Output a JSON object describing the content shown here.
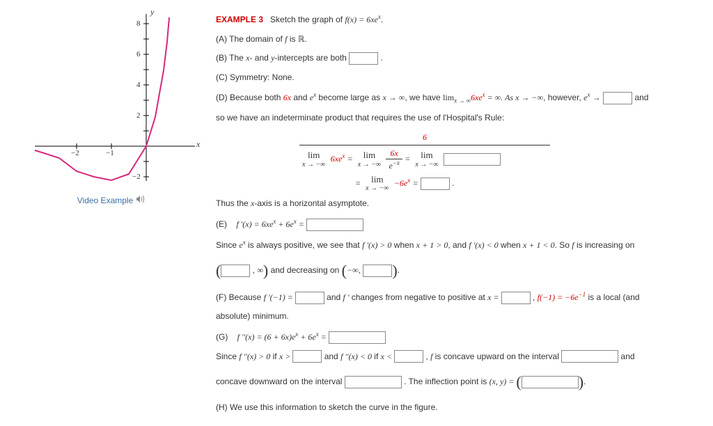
{
  "example_label": "EXAMPLE 3",
  "prompt_prefix": "Sketch the graph of ",
  "prompt_fn": "f(x) = 6xe",
  "prompt_exp": "x",
  "prompt_suffix": ".",
  "video_link": "Video Example",
  "A": {
    "prefix": "(A) The domain of ",
    "fvar": "f",
    "mid": " is ",
    "set": "ℝ",
    "suffix": "."
  },
  "B": {
    "prefix": "(B) The ",
    "x": "x",
    "mid1": "- and ",
    "y": "y",
    "mid2": "-intercepts are both ",
    "suffix": " ."
  },
  "C": "(C) Symmetry: None.",
  "D": {
    "line1a": "(D) Because both ",
    "sixx": "6x",
    "line1b": " and ",
    "ex": "e",
    "exexp": "x",
    "line1c": " become large as ",
    "xto": "x → ∞",
    "line1d": ", we have ",
    "limtxt": "lim",
    "limsub": "x → ∞",
    "limexpr": "6xe",
    "limexp": "x",
    "eqinf": " = ∞. As ",
    "xtoneg": "x → −∞",
    "line1e": ", however, ",
    "exto": "e",
    "line1f": " → ",
    "tail": " and",
    "line2": "so we have an indeterminate product that requires the use of l'Hospital's Rule:",
    "topred": "6",
    "eq": " = ",
    "six": "6",
    "neg6ex": "−6e",
    "closing": "Thus the ",
    "xaxis": "x",
    "closing2": "-axis is a horizontal asymptote."
  },
  "E": {
    "label": "(E)",
    "fprime": "f '(x) = 6xe",
    "exp": "x",
    "plus": " + 6e",
    "eq": " = ",
    "line2a": "Since ",
    "ex": "e",
    "line2b": " is always positive, we see that ",
    "fpx": "f '(x) > 0",
    "line2c": " when ",
    "cond1": "x + 1 > 0",
    "line2d": ", and ",
    "fpx2": "f '(x) < 0",
    "line2e": " when ",
    "cond2": "x + 1 < 0",
    "line2f": ". So ",
    "fvar": "f",
    "line2g": " is increasing on",
    "inf": "∞",
    "dec": " and decreasing on ",
    "neginf": "−∞"
  },
  "F": {
    "prefix": "(F) Because ",
    "fpneg1": "f '(−1) = ",
    "mid1": " and ",
    "fp": "f '",
    "mid2": " changes from negative to positive at ",
    "xeq": "x = ",
    "comma": " , ",
    "fneg1": "f(−1) = −6e",
    "expneg1": "−1",
    "tail": " is a local (and",
    "line2": "absolute) minimum."
  },
  "G": {
    "label": "(G)",
    "fpp": "f ''(x) = (6 + 6x)e",
    "exp": "x",
    "plus": " + 6e",
    "eq": " = ",
    "since": "Since ",
    "fppgt": "f ''(x) > 0",
    "ifxgt": " if ",
    "xgt": "x > ",
    "and": " and ",
    "fpplt": "f ''(x) < 0",
    "xlt": "x < ",
    "comma": " , ",
    "fvar": "f",
    "concup": " is concave upward on the interval ",
    "andtail": " and",
    "concdn": "concave downward on the interval ",
    "inflect": " . The inflection point is ",
    "xy": "(x, y) = "
  },
  "H": "(H) We use this information to sketch the curve in the figure.",
  "graph": {
    "ylabel": "y",
    "xlabel": "x",
    "t_neg2": "−2",
    "t_neg1": "−1",
    "t_y2": "2",
    "t_y4": "4",
    "t_y6": "6",
    "t_y8": "8",
    "t_yn2": "−2"
  },
  "chart_data": {
    "type": "line",
    "title": "f(x) = 6xe^x",
    "xlabel": "x",
    "ylabel": "y",
    "xlim": [
      -3,
      1
    ],
    "ylim": [
      -3,
      9
    ],
    "series": [
      {
        "name": "6xe^x",
        "x": [
          -3.0,
          -2.5,
          -2.0,
          -1.5,
          -1.0,
          -0.5,
          0.0,
          0.25,
          0.5
        ],
        "y": [
          -0.9,
          -1.23,
          -1.62,
          -2.01,
          -2.21,
          -1.82,
          0.0,
          1.93,
          4.95
        ]
      }
    ],
    "asymptote_y": 0,
    "local_min": {
      "x": -1,
      "y": -2.21
    }
  }
}
